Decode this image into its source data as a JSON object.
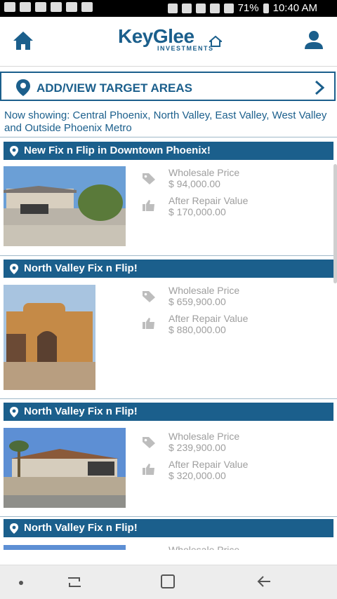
{
  "status_bar": {
    "battery": "71%",
    "time": "10:40 AM"
  },
  "logo": {
    "name": "KeyGlee",
    "sub": "INVESTMENTS"
  },
  "target_areas": {
    "label": "ADD/VIEW TARGET AREAS"
  },
  "now_showing": "Now showing: Central Phoenix, North Valley, East Valley, West Valley and Outside Phoenix Metro",
  "colors": {
    "brand": "#1b5f8c",
    "muted": "#9e9e9e"
  },
  "listings": [
    {
      "title": "New Fix n Flip in Downtown Phoenix!",
      "wholesale_label": "Wholesale Price",
      "wholesale_price": "$ 94,000.00",
      "arv_label": "After Repair Value",
      "arv": "$ 170,000.00"
    },
    {
      "title": "North Valley Fix n Flip!",
      "wholesale_label": "Wholesale Price",
      "wholesale_price": "$ 659,900.00",
      "arv_label": "After Repair Value",
      "arv": "$ 880,000.00"
    },
    {
      "title": "North Valley Fix n Flip!",
      "wholesale_label": "Wholesale Price",
      "wholesale_price": "$ 239,900.00",
      "arv_label": "After Repair Value",
      "arv": "$ 320,000.00"
    },
    {
      "title": "North Valley Fix n Flip!",
      "wholesale_label": "Wholesale Price"
    }
  ]
}
